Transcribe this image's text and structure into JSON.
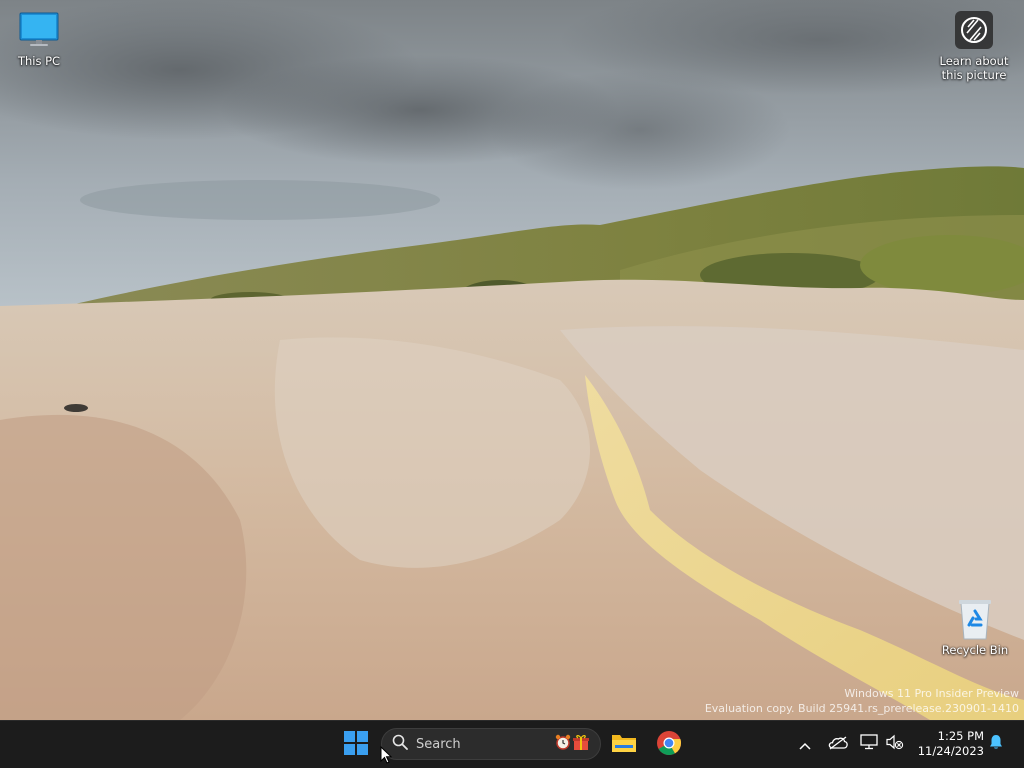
{
  "desktop": {
    "icons": [
      {
        "id": "this-pc",
        "label": "This PC",
        "icon": "monitor-icon"
      },
      {
        "id": "learn",
        "label": "Learn about this picture",
        "icon": "camera-circle-icon"
      },
      {
        "id": "recycle-bin",
        "label": "Recycle Bin",
        "icon": "recycle-bin-icon"
      }
    ],
    "watermark": {
      "line1": "Windows 11 Pro Insider Preview",
      "line2": "Evaluation copy. Build 25941.rs_prerelease.230901-1410"
    }
  },
  "taskbar": {
    "search_placeholder": "Search",
    "pinned": [
      "windows-logo-icon",
      "file-explorer-icon",
      "chrome-icon"
    ],
    "tray_icons": [
      "chevron-up-icon",
      "onedrive-icon",
      "network-icon",
      "volume-muted-icon",
      "notification-bell-icon"
    ],
    "clock": {
      "time": "1:25 PM",
      "date": "11/24/2023"
    }
  },
  "colors": {
    "taskbar_bg": "#1c1c1c",
    "windows_blue": "#3a9ff0",
    "notify_blue": "#4cc2ff"
  }
}
